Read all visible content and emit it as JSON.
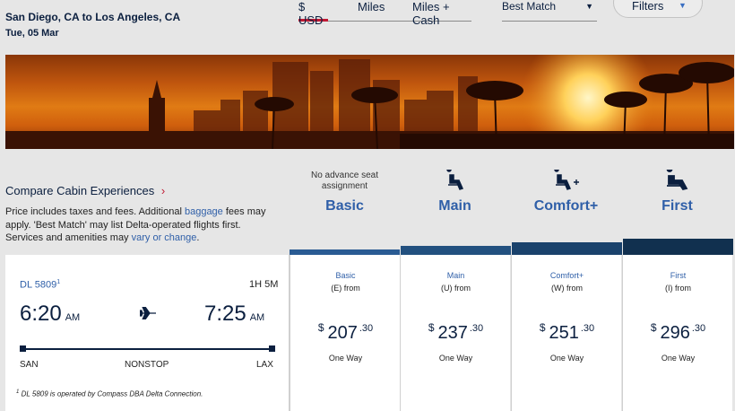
{
  "header": {
    "route": "San Diego, CA to Los Angeles, CA",
    "date": "Tue, 05 Mar"
  },
  "currency_tabs": [
    {
      "label": "$ USD",
      "active": true
    },
    {
      "label": "Miles",
      "active": false
    },
    {
      "label": "Miles + Cash",
      "active": false
    }
  ],
  "sort": {
    "label": "Best Match"
  },
  "filters": {
    "label": "Filters"
  },
  "compare": {
    "label": "Compare Cabin Experiences",
    "note_part1": "Price includes taxes and fees. Additional ",
    "note_link1": "baggage",
    "note_part2": " fees may apply. 'Best Match' may list Delta-operated flights first. Services and amenities may ",
    "note_link2": "vary or change",
    "note_part3": "."
  },
  "cabins": [
    {
      "name": "Basic",
      "note": "No advance seat assignment",
      "icon": "none"
    },
    {
      "name": "Main",
      "note": "",
      "icon": "seat-icon"
    },
    {
      "name": "Comfort+",
      "note": "",
      "icon": "seat-plus-icon"
    },
    {
      "name": "First",
      "note": "",
      "icon": "first-seat-icon"
    }
  ],
  "flight": {
    "number": "DL 5809",
    "footnote_marker": "1",
    "duration": "1H 5M",
    "depart_time": "6:20",
    "depart_ampm": "AM",
    "arrive_time": "7:25",
    "arrive_ampm": "AM",
    "origin": "SAN",
    "stops": "NONSTOP",
    "destination": "LAX",
    "footnote": "DL 5809 is operated by Compass DBA Delta Connection."
  },
  "fares": [
    {
      "cabin": "Basic",
      "class": "(E) from",
      "symbol": "$",
      "amount": "207",
      "cents": ".30",
      "way": "One Way"
    },
    {
      "cabin": "Main",
      "class": "(U) from",
      "symbol": "$",
      "amount": "237",
      "cents": ".30",
      "way": "One Way"
    },
    {
      "cabin": "Comfort+",
      "class": "(W) from",
      "symbol": "$",
      "amount": "251",
      "cents": ".30",
      "way": "One Way"
    },
    {
      "cabin": "First",
      "class": "(I) from",
      "symbol": "$",
      "amount": "296",
      "cents": ".30",
      "way": "One Way"
    }
  ],
  "colors": {
    "navy": "#0b1f3f",
    "link_blue": "#2f5fa8",
    "accent_red": "#c01933",
    "cabin_bar": "#1c4a7a"
  }
}
